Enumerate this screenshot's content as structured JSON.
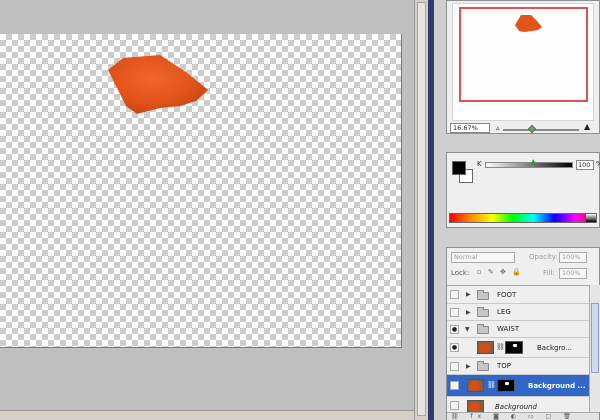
{
  "navigator": {
    "zoom": "16.67%",
    "zoom_out_icon": "mountain-small-icon",
    "zoom_in_icon": "mountain-large-icon"
  },
  "color": {
    "channel_label": "K",
    "channel_value": "100",
    "channel_unit": "%",
    "foreground": "#000000",
    "background": "#ffffff"
  },
  "layers": {
    "blend_mode": "Normal",
    "opacity_label": "Opacity:",
    "opacity_value": "100%",
    "lock_label": "Lock:",
    "lock_icons": "▫ ✎ ✥ 🔒",
    "fill_label": "Fill:",
    "fill_value": "100%",
    "rows": [
      {
        "name": "FOOT",
        "type": "group",
        "expanded": false,
        "visible": false
      },
      {
        "name": "LEG",
        "type": "group",
        "expanded": false,
        "visible": false
      },
      {
        "name": "WAIST",
        "type": "group",
        "expanded": true,
        "visible": true
      },
      {
        "name": "Backgro...",
        "type": "layer-with-mask",
        "visible": true
      },
      {
        "name": "TOP",
        "type": "group",
        "expanded": false,
        "visible": false
      },
      {
        "name": "Background ...",
        "type": "layer-with-mask",
        "visible": false,
        "selected": true
      },
      {
        "name": "Background",
        "type": "layer",
        "visible": false
      }
    ],
    "bottom_icons": "⛓ fx ◙ ◐ ▭ ▢ 🗑"
  },
  "canvas": {
    "shape_color": "#e8561c"
  }
}
